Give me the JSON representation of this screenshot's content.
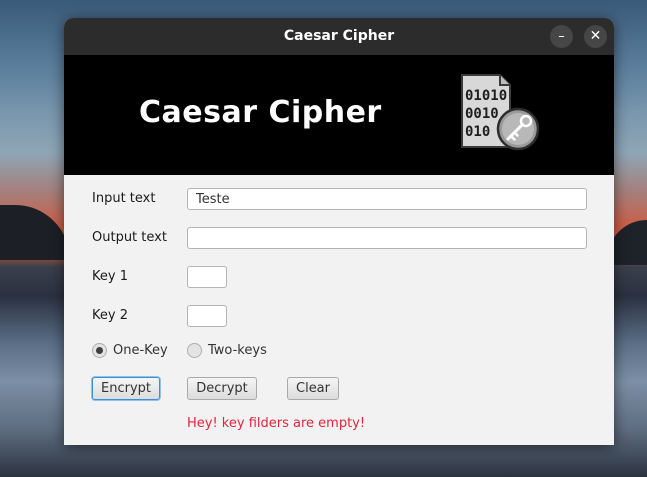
{
  "window": {
    "title": "Caesar Cipher"
  },
  "banner": {
    "heading": "Caesar Cipher",
    "logo_icon": "binary-document-key-icon",
    "logo_digits": [
      "01010",
      "0010",
      "010"
    ]
  },
  "form": {
    "input_label": "Input text",
    "input_value": "Teste",
    "output_label": "Output text",
    "output_value": "",
    "key1_label": "Key 1",
    "key1_value": "",
    "key2_label": "Key 2",
    "key2_value": "",
    "radio_one_label": "One-Key",
    "radio_one_selected": true,
    "radio_two_label": "Two-keys",
    "radio_two_selected": false,
    "encrypt_label": "Encrypt",
    "decrypt_label": "Decrypt",
    "clear_label": "Clear",
    "message": "Hey! key filders are empty!"
  },
  "colors": {
    "banner_bg": "#000000",
    "titlebar_bg": "#2c2c2c",
    "form_bg": "#f2f2f2",
    "message_color": "#e0253d",
    "focus_color": "#3c8fd4"
  }
}
